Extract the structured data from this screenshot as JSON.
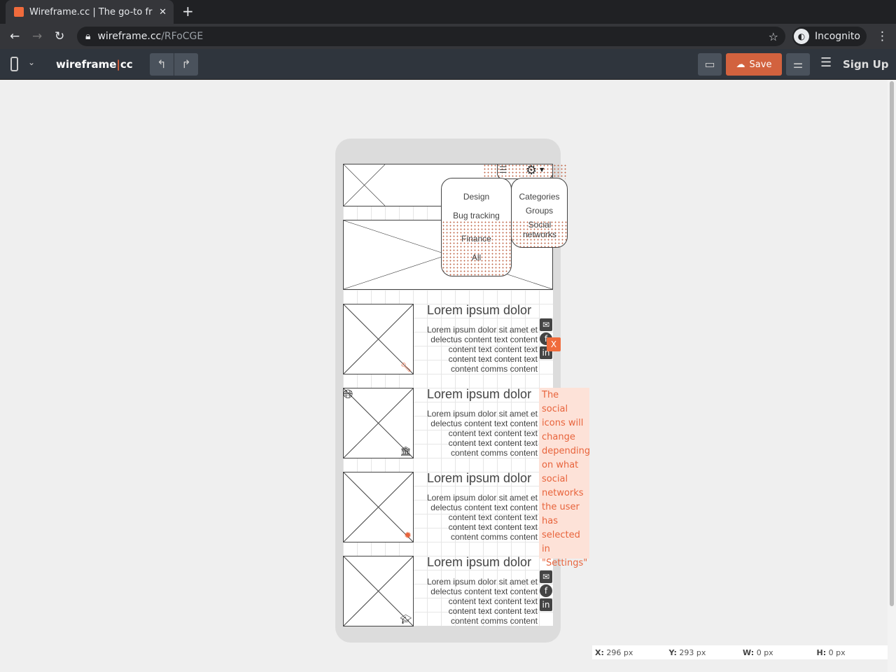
{
  "browser": {
    "tab_title": "Wireframe.cc | The go-to fr",
    "url_host": "wireframe.cc",
    "url_path": "/RFoCGE",
    "profile": "Incognito"
  },
  "toolbar": {
    "logo_left": "wireframe",
    "logo_right": "cc",
    "save_label": "Save",
    "signup_label": "Sign Up"
  },
  "wireframe": {
    "category_menu": [
      "Design",
      "Bug tracking",
      "Finance",
      "All"
    ],
    "settings_menu": [
      "Categories",
      "Groups",
      "Social networks"
    ],
    "cards": [
      {
        "title": "Lorem ipsum dolor",
        "body": "Lorem ipsum dolor sit amet et delectus content text content content text content text content text content text content comms content",
        "badge": "wrench-icon",
        "socials": [
          "email-icon",
          "facebook-icon",
          "linkedin-icon"
        ]
      },
      {
        "title": "Lorem ipsum dolor",
        "body": "Lorem ipsum dolor sit amet et delectus content text content content text content text content text content text content comms content",
        "badge": "bank-icon",
        "socials": []
      },
      {
        "title": "Lorem ipsum dolor",
        "body": "Lorem ipsum dolor sit amet et delectus content text content content text content text content text content text content comms content",
        "badge": "bug-icon",
        "socials": []
      },
      {
        "title": "Lorem ipsum dolor",
        "body": "Lorem ipsum dolor sit amet et delectus content text content content text content text content text content text content comms content",
        "badge": "graduation-cap-icon",
        "socials": [
          "email-icon",
          "facebook-icon",
          "linkedin-icon"
        ]
      }
    ],
    "note": "The social icons will change depending on what social networks the user has selected in \"Settings\"",
    "close_label": "X"
  },
  "status": {
    "x_label": "X:",
    "x": "296 px",
    "y_label": "Y:",
    "y": "293 px",
    "w_label": "W:",
    "w": "0 px",
    "h_label": "H:",
    "h": "0 px"
  },
  "colors": {
    "accent": "#e8643c",
    "save": "#d2623e",
    "note_bg": "#fde2d8"
  }
}
